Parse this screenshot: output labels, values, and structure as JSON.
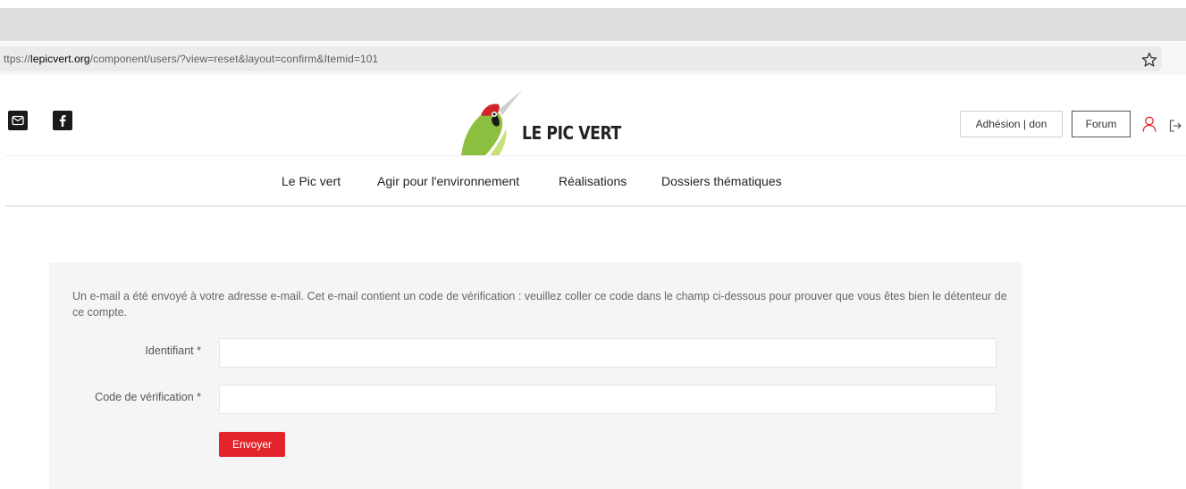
{
  "browser": {
    "url_prefix": "ttps://",
    "url_domain": "lepicvert.org",
    "url_path": "/component/users/?view=reset&layout=confirm&Itemid=101"
  },
  "header": {
    "site_name": "LE PIC VERT",
    "adhesion_label": "Adhésion | don",
    "forum_label": "Forum",
    "icons": [
      "mail-icon",
      "facebook-icon",
      "user-icon",
      "logout-icon",
      "star-icon"
    ]
  },
  "nav": {
    "items": [
      {
        "label": "Le Pic vert"
      },
      {
        "label": "Agir pour l'environnement"
      },
      {
        "label": "Réalisations"
      },
      {
        "label": "Dossiers thématiques"
      }
    ]
  },
  "form": {
    "message": "Un e-mail a été envoyé à votre adresse e-mail. Cet e-mail contient un code de vérification : veuillez coller ce code dans le champ ci-dessous pour prouver que vous êtes bien le détenteur de ce compte.",
    "username_label": "Identifiant *",
    "username_value": "",
    "code_label": "Code de vérification *",
    "code_value": "",
    "submit_label": "Envoyer"
  },
  "colors": {
    "accent": "#e3242b",
    "panel": "#f5f5f5",
    "user_icon": "#e3242b"
  }
}
